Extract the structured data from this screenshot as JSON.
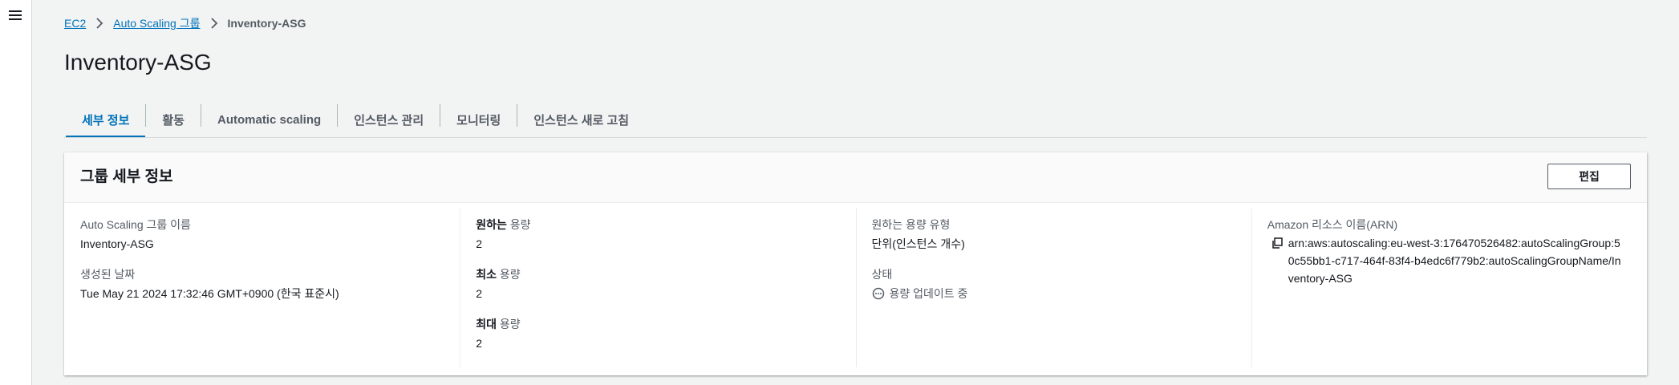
{
  "breadcrumb": {
    "items": [
      "EC2",
      "Auto Scaling 그룹"
    ],
    "current": "Inventory-ASG"
  },
  "page": {
    "title": "Inventory-ASG"
  },
  "tabs": [
    {
      "label": "세부 정보",
      "active": true
    },
    {
      "label": "활동"
    },
    {
      "label": "Automatic scaling"
    },
    {
      "label": "인스턴스 관리"
    },
    {
      "label": "모니터링"
    },
    {
      "label": "인스턴스 새로 고침"
    }
  ],
  "panel": {
    "title": "그룹 세부 정보",
    "edit_label": "편집",
    "col1": {
      "name_label": "Auto Scaling 그룹 이름",
      "name_value": "Inventory-ASG",
      "created_label": "생성된 날짜",
      "created_value": "Tue May 21 2024 17:32:46 GMT+0900 (한국 표준시)"
    },
    "col2": {
      "desired_bold": "원하는",
      "desired_rest": " 용량",
      "desired_value": "2",
      "min_bold": "최소",
      "min_rest": " 용량",
      "min_value": "2",
      "max_bold": "최대",
      "max_rest": " 용량",
      "max_value": "2"
    },
    "col3": {
      "type_label": "원하는 용량 유형",
      "type_value": "단위(인스턴스 개수)",
      "status_label": "상태",
      "status_value": "용량 업데이트 중"
    },
    "col4": {
      "arn_label": "Amazon 리소스 이름(ARN)",
      "arn_value": "arn:aws:autoscaling:eu-west-3:176470526482:autoScalingGroup:50c55bb1-c717-464f-83f4-b4edc6f779b2:autoScalingGroupName/Inventory-ASG"
    }
  },
  "colors": {
    "link": "#0073bb",
    "text": "#16191f",
    "muted": "#545b64",
    "background": "#f2f3f3"
  },
  "icons": [
    "menu-icon",
    "chevron-right-icon",
    "copy-icon",
    "pending-icon"
  ]
}
